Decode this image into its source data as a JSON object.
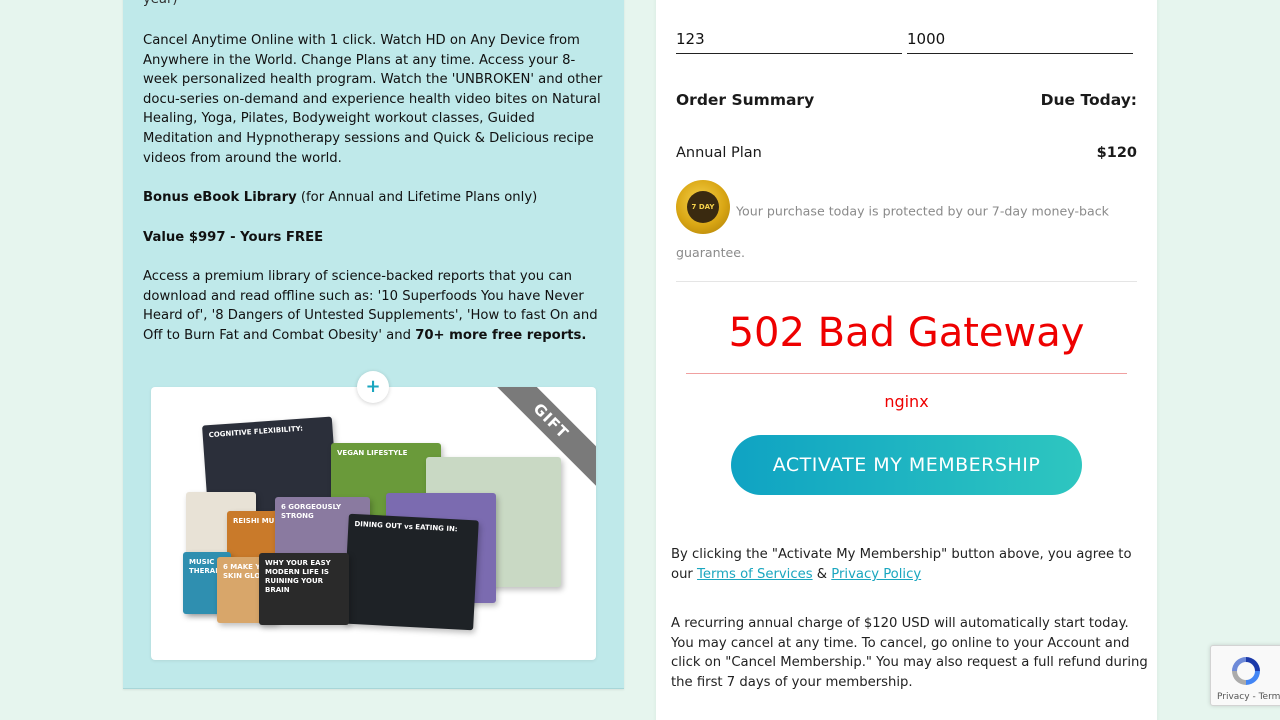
{
  "left": {
    "top_fragment": "year)",
    "description": "Cancel Anytime Online with 1 click. Watch HD on Any Device from Anywhere in the World. Change Plans at any time. Access your 8-week personalized health program. Watch the 'UNBROKEN' and other docu-series on-demand and experience health video bites on Natural Healing, Yoga, Pilates, Bodyweight workout classes, Guided Meditation and Hypnotherapy sessions and Quick & Delicious recipe videos from around the world.",
    "bonus_title": "Bonus eBook Library",
    "bonus_note": " (for Annual and Lifetime Plans only)",
    "value_line": "Value $997 - Yours FREE",
    "library_text": "Access a premium library of science-backed reports that you can download and read offline such as: '10 Superfoods You have Never Heard of', '8 Dangers of Untested Supplements', 'How to fast On and Off to Burn Fat and Combat Obesity' and ",
    "library_more": "70+ more free reports.",
    "plus_label": "+",
    "gift_label": "GIFT",
    "books": [
      {
        "title": "COGNITIVE FLEXIBILITY:",
        "color": "#2b2f3a"
      },
      {
        "title": "VEGAN LIFESTYLE",
        "color": "#6a9a3a"
      },
      {
        "title": "REISHI MU",
        "color": "#c97a2a"
      },
      {
        "title": "6 GORGEOUSLY STRONG",
        "color": "#8a7aa0"
      },
      {
        "title": "DINING OUT vs EATING IN:",
        "color": "#1e2226"
      },
      {
        "title": "MUSIC THERAP",
        "color": "#2f8fb0"
      },
      {
        "title": "6 MAKE YOU SKIN GLO",
        "color": "#d8a66a"
      },
      {
        "title": "WHY YOUR EASY MODERN LIFE IS RUINING YOUR BRAIN",
        "color": "#2a2a2a"
      }
    ]
  },
  "right": {
    "cvv_value": "123",
    "zip_value": "1000",
    "order_summary_label": "Order Summary",
    "due_today_label": "Due Today:",
    "plan_name": "Annual Plan",
    "plan_price": "$120",
    "badge_text": "7 DAY",
    "guarantee_text": "Your purchase today is protected by our 7-day money-back guarantee.",
    "error_title": "502 Bad Gateway",
    "error_server": "nginx",
    "activate_label": "ACTIVATE MY MEMBERSHIP",
    "agree_prefix": "By clicking the \"Activate My Membership\" button above, you agree to our ",
    "terms_label": "Terms of Services",
    "amp": " & ",
    "privacy_label": "Privacy Policy",
    "recurring_text": "A recurring annual charge of $120 USD will automatically start today. You may cancel at any time. To cancel, go online to your Account and click on \"Cancel Membership.\" You may also request a full refund during the first 7 days of your membership."
  },
  "recaptcha": {
    "privacy": "Privacy",
    "sep": " - ",
    "terms": "Terms"
  },
  "colors": {
    "left_bg": "#bfe9ea",
    "page_bg": "#e6f5ee",
    "error_red": "#ee0000",
    "link": "#1aa6bf"
  }
}
